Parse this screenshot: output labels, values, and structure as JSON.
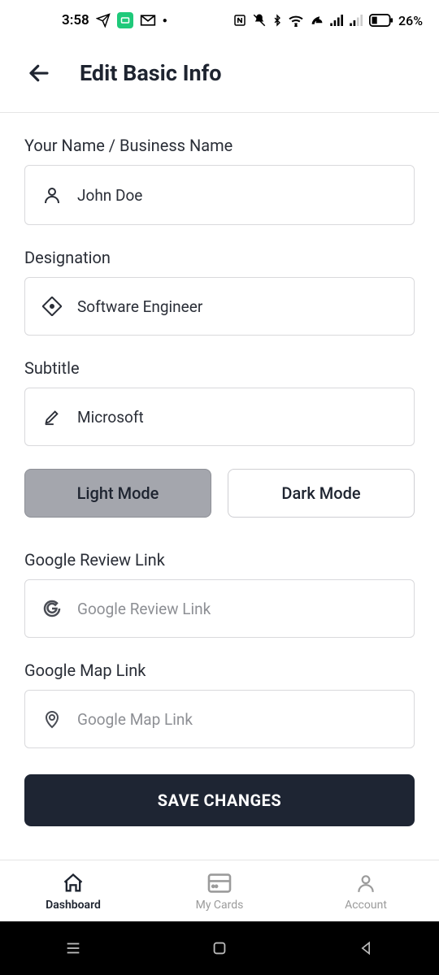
{
  "status": {
    "time": "3:58",
    "battery": "26%"
  },
  "header": {
    "title": "Edit Basic Info"
  },
  "form": {
    "name": {
      "label": "Your Name / Business Name",
      "value": "John Doe"
    },
    "designation": {
      "label": "Designation",
      "value": "Software Engineer"
    },
    "subtitle": {
      "label": "Subtitle",
      "value": "Microsoft"
    },
    "mode": {
      "light": "Light Mode",
      "dark": "Dark Mode"
    },
    "review": {
      "label": "Google Review Link",
      "placeholder": "Google Review Link",
      "value": ""
    },
    "map": {
      "label": "Google Map Link",
      "placeholder": "Google Map Link",
      "value": ""
    },
    "save": "SAVE CHANGES"
  },
  "nav": {
    "dashboard": "Dashboard",
    "cards": "My Cards",
    "account": "Account"
  }
}
